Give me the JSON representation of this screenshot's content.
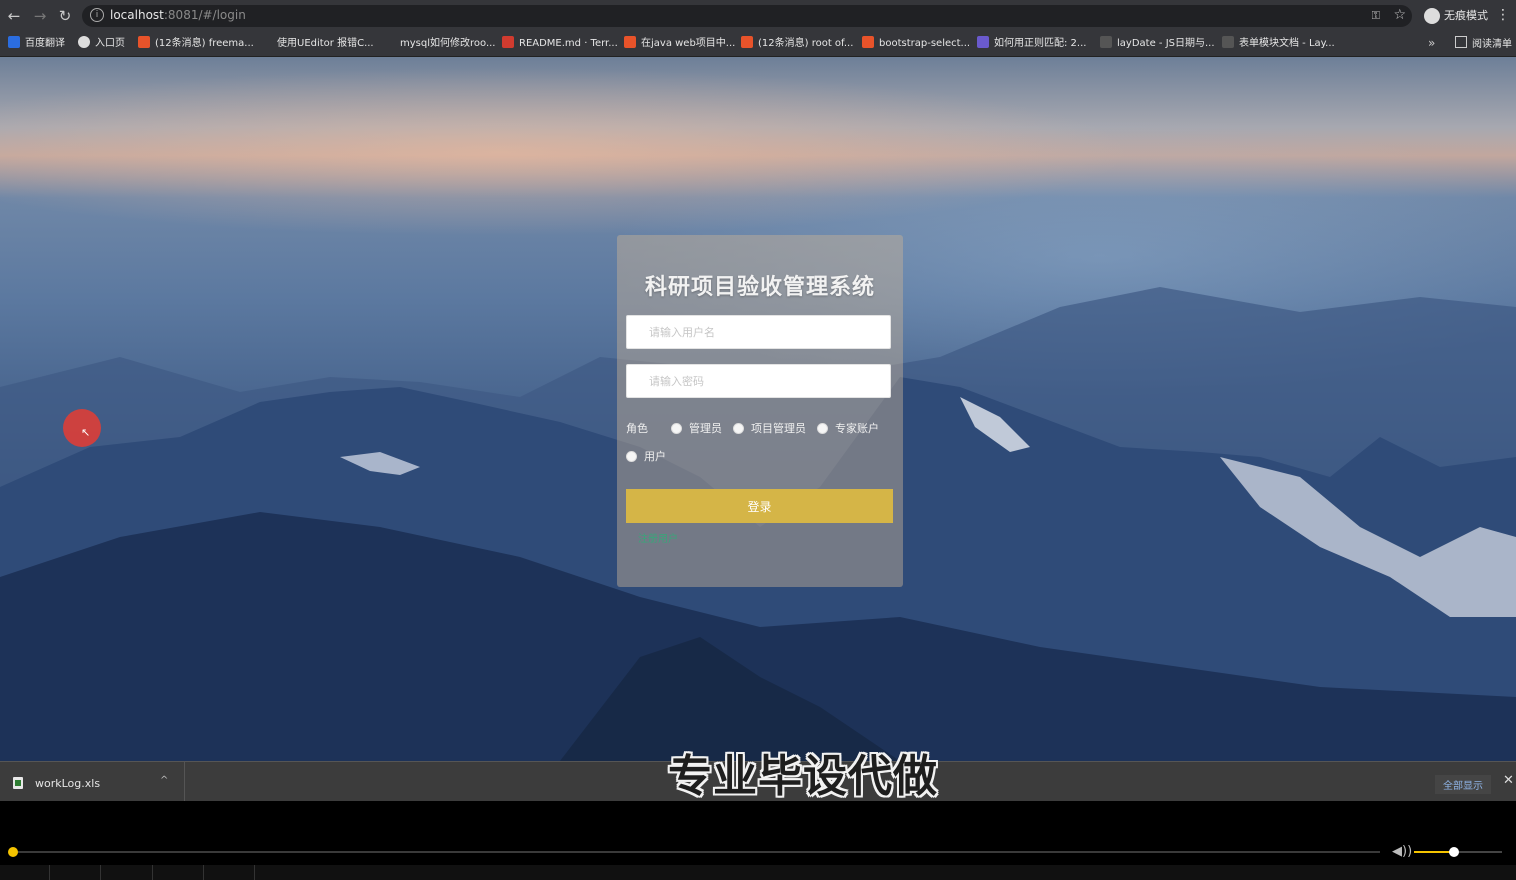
{
  "browser": {
    "url_host": "localhost",
    "url_path": ":8081/#/login",
    "incognito_label": "无痕模式",
    "bookmarks": [
      {
        "label": "百度翻译",
        "color": "#2b6de0"
      },
      {
        "label": "入口页",
        "color": "#ffffff"
      },
      {
        "label": "(12条消息) freema...",
        "color": "#e8532a"
      },
      {
        "label": "使用UEditor 报错C...",
        "color": "#35363a"
      },
      {
        "label": "mysql如何修改roo...",
        "color": "#35363a"
      },
      {
        "label": "README.md · Terr...",
        "color": "#d13b2f"
      },
      {
        "label": "在java web项目中...",
        "color": "#e8532a"
      },
      {
        "label": "(12条消息) root of...",
        "color": "#e8532a"
      },
      {
        "label": "bootstrap-select...",
        "color": "#e8532a"
      },
      {
        "label": "如何用正则匹配: 2...",
        "color": "#6a5acd"
      },
      {
        "label": "layDate - JS日期与...",
        "color": "#35363a"
      },
      {
        "label": "表单模块文档 - Lay...",
        "color": "#35363a"
      }
    ],
    "reading_list": "阅读清单"
  },
  "login": {
    "title": "科研项目验收管理系统",
    "username_placeholder": "请输入用户名",
    "password_placeholder": "请输入密码",
    "role_label": "角色",
    "roles": [
      "管理员",
      "项目管理员",
      "专家账户",
      "用户"
    ],
    "login_button": "登录",
    "register_link": "注册用户"
  },
  "watermark": "专业毕设代做",
  "downloads": {
    "file_name": "workLog.xls",
    "show_all": "全部显示"
  },
  "player": {
    "progress": 0.0,
    "volume": 0.45,
    "accent": "#f5c400"
  }
}
